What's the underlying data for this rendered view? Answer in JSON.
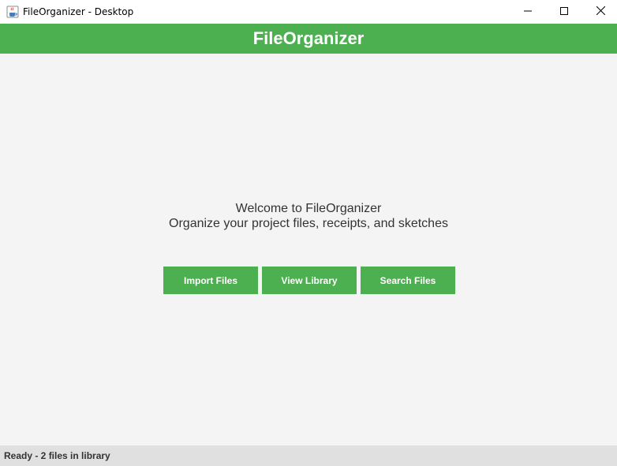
{
  "window": {
    "title": "FileOrganizer - Desktop",
    "controls": [
      "minimize",
      "maximize",
      "close"
    ]
  },
  "header": {
    "title": "FileOrganizer"
  },
  "main": {
    "welcome_line1": "Welcome to FileOrganizer",
    "welcome_line2": "Organize your project files, receipts, and sketches",
    "buttons": {
      "import_label": "Import Files",
      "view_label": "View Library",
      "search_label": "Search Files"
    }
  },
  "status": {
    "text": "Ready - 2 files in library"
  },
  "colors": {
    "accent": "#4caf50",
    "content_bg": "#f4f4f4",
    "status_bg": "#e0e0e0"
  },
  "icons": {
    "app": "java-coffee-cup-icon",
    "minimize": "minimize-icon",
    "maximize": "maximize-icon",
    "close": "close-icon"
  }
}
